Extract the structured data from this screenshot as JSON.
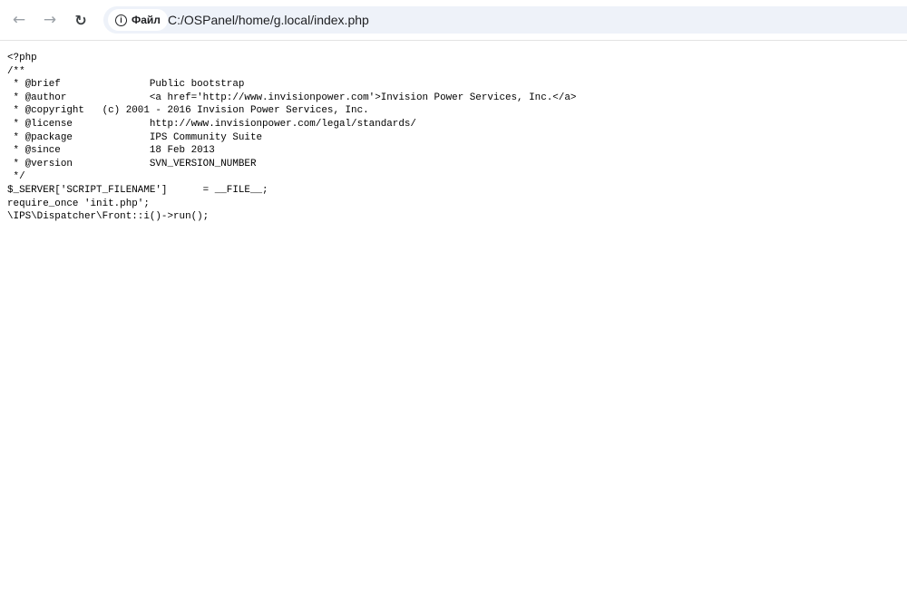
{
  "browser": {
    "back_icon": "arrow-left-icon",
    "forward_icon": "arrow-right-icon",
    "reload_icon": "reload-icon",
    "security_chip_label": "Файл",
    "url": "C:/OSPanel/home/g.local/index.php"
  },
  "content": {
    "lines": [
      "<?php",
      "/**",
      " * @brief               Public bootstrap",
      " * @author              <a href='http://www.invisionpower.com'>Invision Power Services, Inc.</a>",
      " * @copyright   (c) 2001 - 2016 Invision Power Services, Inc.",
      " * @license             http://www.invisionpower.com/legal/standards/",
      " * @package             IPS Community Suite",
      " * @since               18 Feb 2013",
      " * @version             SVN_VERSION_NUMBER",
      " */",
      "$_SERVER['SCRIPT_FILENAME']      = __FILE__;",
      "require_once 'init.php';",
      "\\IPS\\Dispatcher\\Front::i()->run();"
    ]
  }
}
